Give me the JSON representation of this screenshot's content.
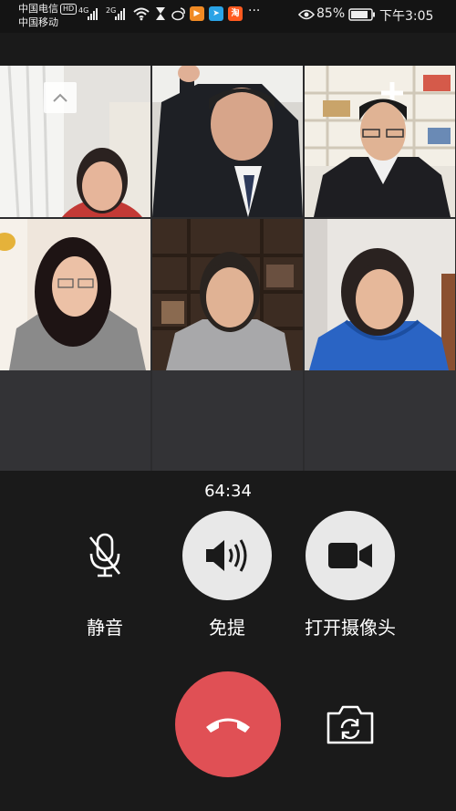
{
  "status_bar": {
    "carrier1": "中国电信",
    "hd_badge": "HD",
    "carrier2": "中国移动",
    "net1": "4G",
    "net2": "2G",
    "battery": "85%",
    "time": "下午3:05",
    "more": "···",
    "icons": [
      "signal-icon",
      "wifi-icon",
      "hourglass-icon",
      "weibo-icon",
      "video-app-icon",
      "telegram-icon",
      "taobao-icon",
      "eye-icon",
      "battery-icon"
    ]
  },
  "call": {
    "duration": "64:34",
    "participants": 6
  },
  "controls": {
    "mute_label": "静音",
    "speaker_label": "免提",
    "camera_label": "打开摄像头"
  },
  "colors": {
    "background": "#1a1a1a",
    "button": "#e8e8e8",
    "hangup": "#e05055"
  }
}
